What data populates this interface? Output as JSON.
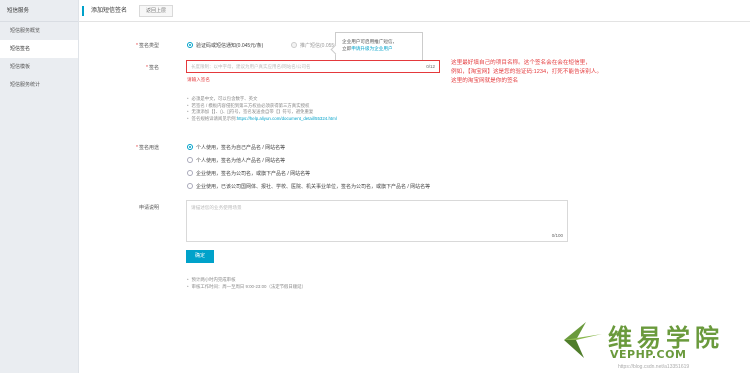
{
  "sidebar": {
    "title": "短信服务",
    "items": [
      {
        "label": "短信服务概览",
        "active": false
      },
      {
        "label": "短信签名",
        "active": true
      },
      {
        "label": "短信模板",
        "active": false
      },
      {
        "label": "短信服务统计",
        "active": false
      }
    ]
  },
  "header": {
    "title": "添加短信签名",
    "back_label": "返回上层"
  },
  "form": {
    "sign_type": {
      "label": "签名类型",
      "options": [
        {
          "label": "验证码或短信通知(0.045元/条)",
          "checked": true,
          "disabled": false
        },
        {
          "label": "推广短信(0.055元/条)",
          "checked": false,
          "disabled": true
        }
      ]
    },
    "tooltip": {
      "line1": "企业用户可启用推广短信，",
      "line2_prefix": "立即",
      "line2_link": "申请升级为企业用户"
    },
    "signature": {
      "label": "签名",
      "placeholder": "长度限制：以中字母，建议为用户真实应用名/网站名/公司名",
      "count": "0/12",
      "error": "请输入签名"
    },
    "annotation": {
      "line1": "这里最好填自己的项目名称。这个签名会在会在短信里，",
      "line2": "例如，【淘宝网】这是您的验证码:1234，打死不能告诉别人。",
      "line3": "这里的淘宝网就是你的签名"
    },
    "hints": [
      "必须是中文，可以包含数字、英文",
      "若签名 / 模板内容侵犯到第三方权益必须获得第三方真实授权",
      "无须添加【】、()、[]符号，签名发送会自带【】符号，避免重复",
      "签名规格详请阅见示例:"
    ],
    "hint_link": "https://help.aliyun.com/document_detail/55324.html",
    "usage": {
      "label": "签名用途",
      "options": [
        {
          "label": "个人使用，签名为自己产品名 / 网站名等",
          "checked": true
        },
        {
          "label": "个人使用，签名为他人产品名 / 网站名等",
          "checked": false
        },
        {
          "label": "企业使用，签名为公司名，或旗下产品名 / 网站名等",
          "checked": false
        },
        {
          "label": "企业使用，已该公司国网体、报社、学校、医院、机关事业单位，签名为公司名，或旗下产品名 / 网站名等",
          "checked": false
        }
      ]
    },
    "apply_note": {
      "label": "申请说明",
      "placeholder": "请描述您的业务使用场景",
      "count": "0/100"
    },
    "submit_label": "确定",
    "notes": [
      "预计两小时内完成审核",
      "审核工作时间：周一至周日 9:00-23:00（法定节假日顺延）"
    ]
  },
  "watermark": {
    "chinese": "维易学院",
    "latin": "VEPHP.COM",
    "url": "https://blog.csdn.net/a13351619"
  },
  "colors": {
    "accent": "#00a2ca",
    "error": "#e4393c",
    "sidebar_bg": "#eaedf1",
    "watermark": "#6a9a3c"
  }
}
